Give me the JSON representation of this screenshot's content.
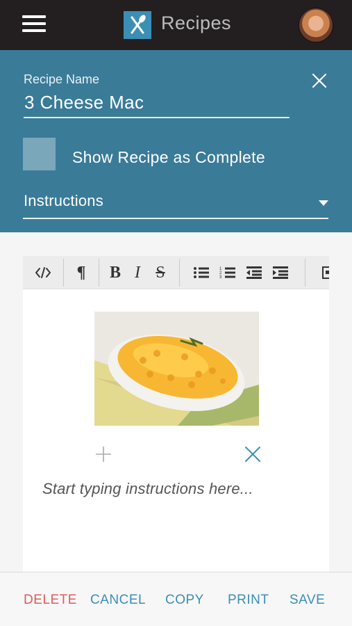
{
  "header": {
    "app_title": "Recipes"
  },
  "form": {
    "recipe_name_label": "Recipe Name",
    "recipe_name_value": "3 Cheese Mac",
    "complete_label": "Show Recipe as Complete",
    "complete_checked": false,
    "section_selected": "Instructions"
  },
  "editor": {
    "toolbar": [
      "code-view",
      "paragraph",
      "bold",
      "italic",
      "strikethrough",
      "bulleted-list",
      "numbered-list",
      "outdent",
      "indent",
      "insert-image"
    ],
    "instructions_placeholder": "Start typing instructions here..."
  },
  "actions": {
    "delete": "DELETE",
    "cancel": "CANCEL",
    "copy": "COPY",
    "print": "PRINT",
    "save": "SAVE"
  },
  "colors": {
    "topbar": "#231f20",
    "panel": "#3a7b98",
    "accent_blue": "#3b8fb5",
    "danger": "#e15a5a"
  }
}
